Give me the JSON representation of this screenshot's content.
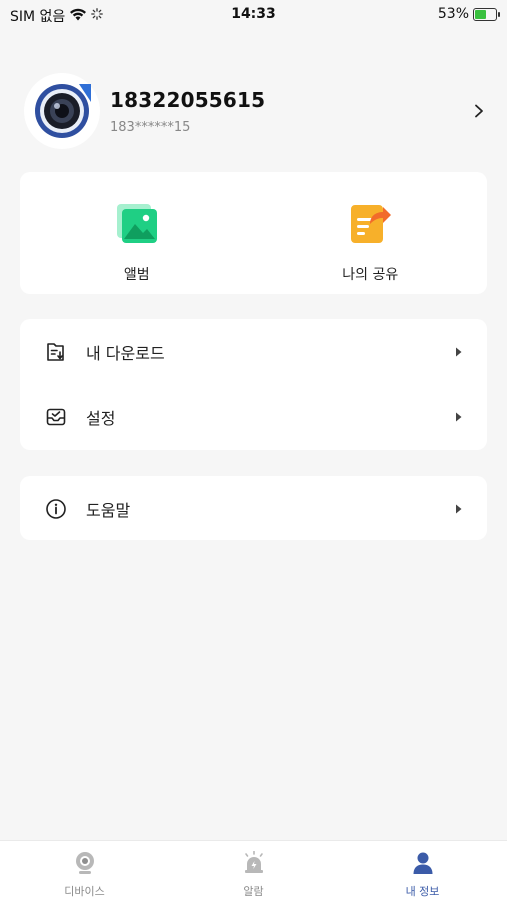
{
  "status_bar": {
    "carrier": "SIM 없음",
    "time": "14:33",
    "battery_percent": "53%",
    "battery_level": 0.53
  },
  "profile": {
    "name": "18322055615",
    "masked_id": "183******15"
  },
  "shortcuts": [
    {
      "label": "앨범",
      "icon": "album-icon"
    },
    {
      "label": "나의 공유",
      "icon": "share-icon"
    }
  ],
  "menu": [
    {
      "label": "내 다운로드",
      "icon": "download-folder-icon"
    },
    {
      "label": "설정",
      "icon": "settings-tray-icon"
    }
  ],
  "help": {
    "label": "도움말",
    "icon": "info-icon"
  },
  "bottom_nav": [
    {
      "label": "디바이스",
      "icon": "camera-device-icon",
      "active": false
    },
    {
      "label": "알람",
      "icon": "alarm-icon",
      "active": false
    },
    {
      "label": "내 정보",
      "icon": "user-icon",
      "active": true
    }
  ],
  "colors": {
    "accent": "#3b5ba8",
    "album_green": "#1fcf84",
    "share_orange": "#f7b02a",
    "background": "#f6f6f6"
  }
}
